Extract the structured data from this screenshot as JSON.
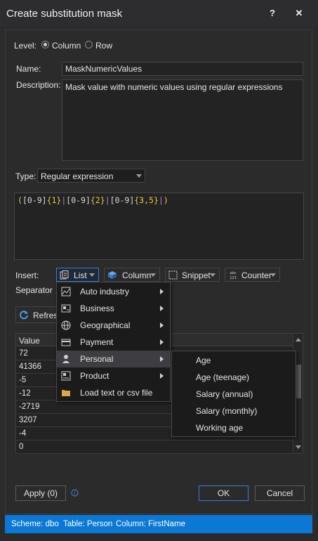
{
  "window": {
    "title": "Create substitution mask",
    "help_label": "?",
    "close_label": "✕"
  },
  "level": {
    "label": "Level:",
    "options": [
      "Column",
      "Row"
    ],
    "selected": "Column"
  },
  "name": {
    "label": "Name:",
    "value": "MaskNumericValues"
  },
  "description": {
    "label": "Description:",
    "value": "Mask value with numeric values using regular expressions"
  },
  "type": {
    "label": "Type:",
    "value": "Regular expression"
  },
  "expression": {
    "tokens": [
      {
        "t": "(",
        "c": "tok-y"
      },
      {
        "t": "[0-9]",
        "c": "tok-w"
      },
      {
        "t": "{1}",
        "c": "tok-y"
      },
      {
        "t": "|",
        "c": "tok-p"
      },
      {
        "t": "[0-9]",
        "c": "tok-w"
      },
      {
        "t": "{2}",
        "c": "tok-y"
      },
      {
        "t": "|",
        "c": "tok-p"
      },
      {
        "t": "[0-9]",
        "c": "tok-w"
      },
      {
        "t": "{3,5}",
        "c": "tok-y"
      },
      {
        "t": "|",
        "c": "tok-p"
      },
      {
        "t": ")",
        "c": "tok-y"
      }
    ]
  },
  "insert": {
    "label": "Insert:",
    "list_label": "List",
    "column_label": "Column",
    "snippet_label": "Snippet",
    "counter_label": "Counter",
    "separator_label": "Separator"
  },
  "refresh_label": "Refresh",
  "grid": {
    "header": "Value",
    "rows": [
      "72",
      "41366",
      "-5",
      "-12",
      "-2719",
      "3207",
      "-4",
      "0"
    ]
  },
  "list_menu": {
    "items": [
      {
        "label": "Auto industry",
        "icon": "chart-icon",
        "submenu": true
      },
      {
        "label": "Business",
        "icon": "business-card-icon",
        "submenu": true
      },
      {
        "label": "Geographical",
        "icon": "globe-icon",
        "submenu": true
      },
      {
        "label": "Payment",
        "icon": "card-icon",
        "submenu": true
      },
      {
        "label": "Personal",
        "icon": "person-icon",
        "submenu": true
      },
      {
        "label": "Product",
        "icon": "product-icon",
        "submenu": true
      },
      {
        "label": "Load text or csv file",
        "icon": "folder-icon",
        "submenu": false
      }
    ],
    "highlighted": "Personal"
  },
  "personal_submenu": {
    "items": [
      "Age",
      "Age (teenage)",
      "Salary (annual)",
      "Salary (monthly)",
      "Working age"
    ]
  },
  "footer": {
    "apply_label": "Apply (0)",
    "info_label": "i",
    "ok_label": "OK",
    "cancel_label": "Cancel"
  },
  "status": {
    "scheme": "Scheme: dbo",
    "table": "Table: Person",
    "column": "Column: FirstName"
  },
  "colors": {
    "accent": "#0a78d4",
    "background": "#2b2b2b",
    "highlight": "#3e3e42"
  }
}
